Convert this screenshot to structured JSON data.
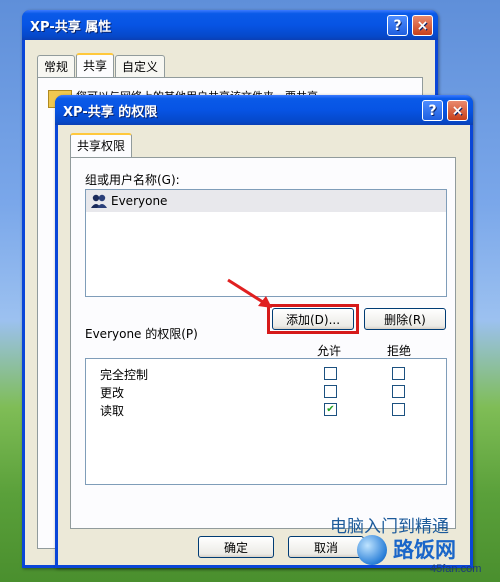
{
  "back_window": {
    "title": "XP-共享 属性",
    "help_label": "?",
    "close_label": "×",
    "tabs": [
      "常规",
      "共享",
      "自定义"
    ],
    "info_text": "您可以与网络上的其他用户共享该文件夹。要共享"
  },
  "dialog": {
    "title": "XP-共享 的权限",
    "help_label": "?",
    "close_label": "×",
    "tab_label": "共享权限",
    "group_label": "组或用户名称(G):",
    "users": [
      {
        "name": "Everyone",
        "icon": "user-group-icon"
      }
    ],
    "add_button": "添加(D)...",
    "remove_button": "删除(R)",
    "permissions_label": "Everyone 的权限(P)",
    "col_allow": "允许",
    "col_deny": "拒绝",
    "permissions": [
      {
        "name": "完全控制",
        "allow": false,
        "deny": false
      },
      {
        "name": "更改",
        "allow": false,
        "deny": false
      },
      {
        "name": "读取",
        "allow": true,
        "deny": false
      }
    ],
    "ok_button": "确定",
    "cancel_button": "取消"
  },
  "watermark": {
    "top": "电脑入门到精通",
    "brand": "路饭网",
    "url": "45fan.com"
  },
  "colors": {
    "titlebar": "#0754e4",
    "highlight_box": "#d61a1a",
    "arrow": "#e02020",
    "selected_row": "#e8e8ec"
  }
}
